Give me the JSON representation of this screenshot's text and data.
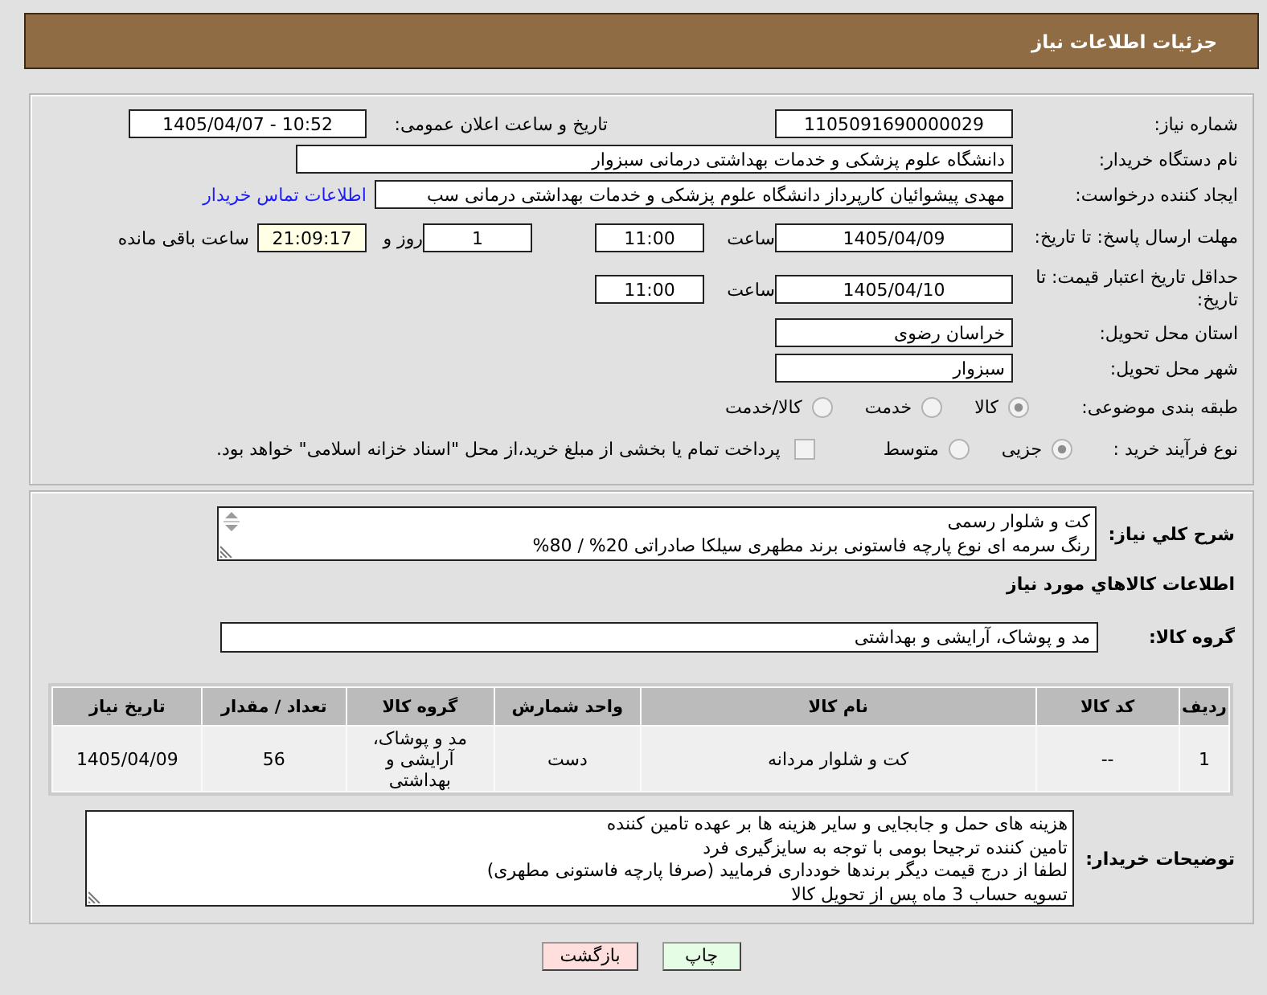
{
  "header": {
    "title": "جزئیات اطلاعات نیاز"
  },
  "details": {
    "need_number": {
      "label": "شماره نیاز:",
      "value": "1105091690000029"
    },
    "announce": {
      "label": "تاریخ و ساعت اعلان عمومی:",
      "value": "1405/04/07 - 10:52"
    },
    "buyer_org": {
      "label": "نام دستگاه خریدار:",
      "value": "دانشگاه علوم پزشکی و خدمات بهداشتی  درمانی سبزوار"
    },
    "requester": {
      "label": "ایجاد کننده درخواست:",
      "value": "مهدی پیشوائیان کارپرداز دانشگاه علوم پزشکی و خدمات بهداشتی  درمانی سب",
      "link": "اطلاعات تماس خریدار"
    },
    "reply_deadline": {
      "label": "مهلت ارسال پاسخ: تا تاریخ:",
      "date": "1405/04/09",
      "time_label": "ساعت",
      "time": "11:00",
      "days": "1",
      "days_label": "روز و",
      "remaining": "21:09:17",
      "remaining_label": "ساعت باقی مانده"
    },
    "price_validity": {
      "label": "حداقل تاریخ اعتبار قیمت: تا تاریخ:",
      "date": "1405/04/10",
      "time_label": "ساعت",
      "time": "11:00"
    },
    "province": {
      "label": "استان محل تحویل:",
      "value": "خراسان رضوی"
    },
    "city": {
      "label": "شهر محل تحویل:",
      "value": "سبزوار"
    },
    "category": {
      "label": "طبقه بندی موضوعی:",
      "options": [
        {
          "label": "کالا",
          "selected": true
        },
        {
          "label": "خدمت",
          "selected": false
        },
        {
          "label": "کالا/خدمت",
          "selected": false
        }
      ]
    },
    "process": {
      "label": "نوع فرآیند خرید :",
      "options": [
        {
          "label": "جزیی",
          "selected": true
        },
        {
          "label": "متوسط",
          "selected": false
        }
      ],
      "treasury": {
        "checked": false,
        "label": "پرداخت تمام یا بخشی از مبلغ خرید،از محل \"اسناد خزانه اسلامی\" خواهد بود."
      }
    }
  },
  "description": {
    "label": "شرح کلي نياز:",
    "lines": [
      "کت و شلوار رسمی",
      "رنگ سرمه ای نوع پارچه فاستونی برند مطهری سیلکا صادراتی 20% / 80%"
    ]
  },
  "goods": {
    "title": "اطلاعات کالاهاي مورد نياز",
    "group_label": "گروه کالا:",
    "group": "مد و پوشاک، آرایشی و بهداشتی",
    "table": {
      "columns": [
        "ردیف",
        "کد کالا",
        "نام کالا",
        "واحد شمارش",
        "گروه کالا",
        "تعداد / مقدار",
        "تاریخ نیاز"
      ],
      "rows": [
        [
          "1",
          "--",
          "کت و شلوار مردانه",
          "دست",
          "مد و پوشاک، آرایشی و بهداشتی",
          "56",
          "1405/04/09"
        ]
      ]
    }
  },
  "buyer_notes": {
    "label": "توضیحات خریدار:",
    "lines": [
      "هزینه های حمل و جابجایی و سایر هزینه ها بر عهده تامین کننده",
      "تامین کننده ترجیحا بومی با توجه به سایزگیری فرد",
      "لطفا از درج قیمت دیگر برندها خودداری فرمایید (صرفا پارچه فاستونی مطهری)",
      "تسویه حساب 3 ماه پس از تحویل کالا"
    ]
  },
  "buttons": [
    {
      "label": "چاپ",
      "kind": "print"
    },
    {
      "label": "بازگشت",
      "kind": "back"
    }
  ]
}
